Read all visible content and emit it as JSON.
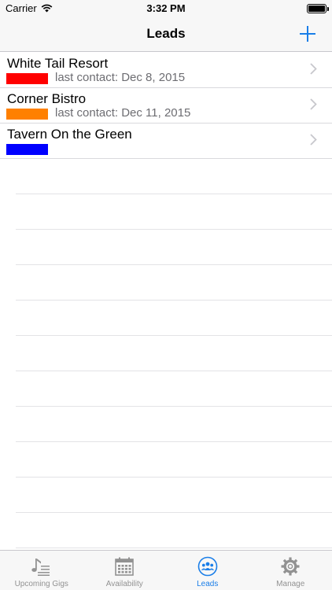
{
  "status_bar": {
    "carrier": "Carrier",
    "time": "3:32 PM"
  },
  "nav": {
    "title": "Leads",
    "add_icon": "plus-icon"
  },
  "leads": [
    {
      "name": "White Tail Resort",
      "contact": "last contact: Dec 8, 2015",
      "color": "#ff0000"
    },
    {
      "name": "Corner Bistro",
      "contact": "last contact: Dec 11, 2015",
      "color": "#ff8000"
    },
    {
      "name": "Tavern On the Green",
      "contact": "",
      "color": "#0000ff"
    }
  ],
  "tabs": [
    {
      "label": "Upcoming Gigs",
      "icon": "music-notes-icon",
      "active": false
    },
    {
      "label": "Availability",
      "icon": "calendar-icon",
      "active": false
    },
    {
      "label": "Leads",
      "icon": "people-icon",
      "active": true
    },
    {
      "label": "Manage",
      "icon": "gear-icon",
      "active": false
    }
  ],
  "colors": {
    "accent": "#1a7ee8",
    "inactive": "#929292"
  }
}
